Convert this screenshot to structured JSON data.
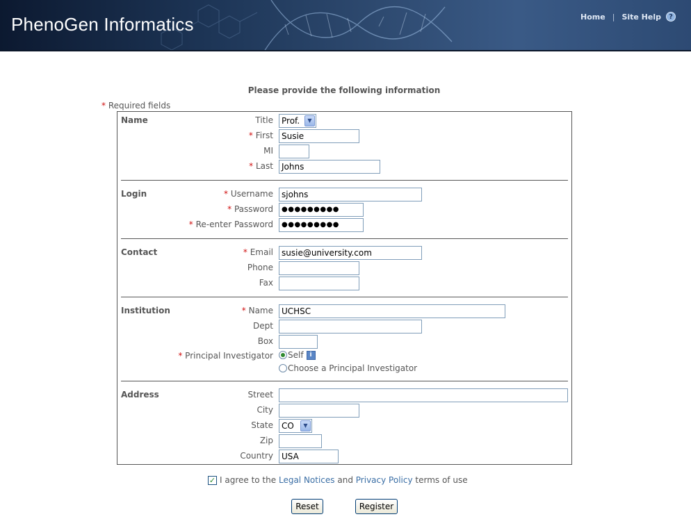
{
  "header": {
    "app_title": "PhenoGen Informatics",
    "nav": {
      "home": "Home",
      "separator": "|",
      "site_help": "Site Help",
      "help_icon": "?"
    }
  },
  "form": {
    "heading": "Please provide the following information",
    "required_marker": "*",
    "required_note": "Required fields",
    "sections": {
      "name": {
        "title": "Name",
        "title_label": "Title",
        "title_value": "Prof.",
        "first_label": "First",
        "first_value": "Susie",
        "mi_label": "MI",
        "mi_value": "",
        "last_label": "Last",
        "last_value": "Johns"
      },
      "login": {
        "title": "Login",
        "username_label": "Username",
        "username_value": "sjohns",
        "password_label": "Password",
        "password_value": "●●●●●●●●●",
        "reenter_label": "Re-enter Password",
        "reenter_value": "●●●●●●●●●"
      },
      "contact": {
        "title": "Contact",
        "email_label": "Email",
        "email_value": "susie@university.com",
        "phone_label": "Phone",
        "phone_value": "",
        "fax_label": "Fax",
        "fax_value": ""
      },
      "institution": {
        "title": "Institution",
        "name_label": "Name",
        "name_value": "UCHSC",
        "dept_label": "Dept",
        "dept_value": "",
        "box_label": "Box",
        "box_value": "",
        "pi_label": "Principal Investigator",
        "pi_option_self": "Self",
        "pi_option_choose": "Choose a Principal Investigator",
        "info_icon": "i"
      },
      "address": {
        "title": "Address",
        "street_label": "Street",
        "street_value": "",
        "city_label": "City",
        "city_value": "",
        "state_label": "State",
        "state_value": "CO",
        "zip_label": "Zip",
        "zip_value": "",
        "country_label": "Country",
        "country_value": "USA"
      }
    },
    "agree": {
      "checkmark": "✓",
      "prefix": "I agree to the",
      "legal_link": "Legal Notices",
      "and": "and",
      "privacy_link": "Privacy Policy",
      "suffix": "terms of use"
    },
    "buttons": {
      "reset": "Reset",
      "register": "Register"
    }
  },
  "colors": {
    "header_bg": "#1d3556",
    "required": "#d01010",
    "link": "#3a6ea5",
    "radio_selected": "#2f8a2f"
  },
  "icons": {
    "help": "help-circle-icon",
    "info": "info-icon",
    "select_arrow": "chevron-down-icon"
  }
}
